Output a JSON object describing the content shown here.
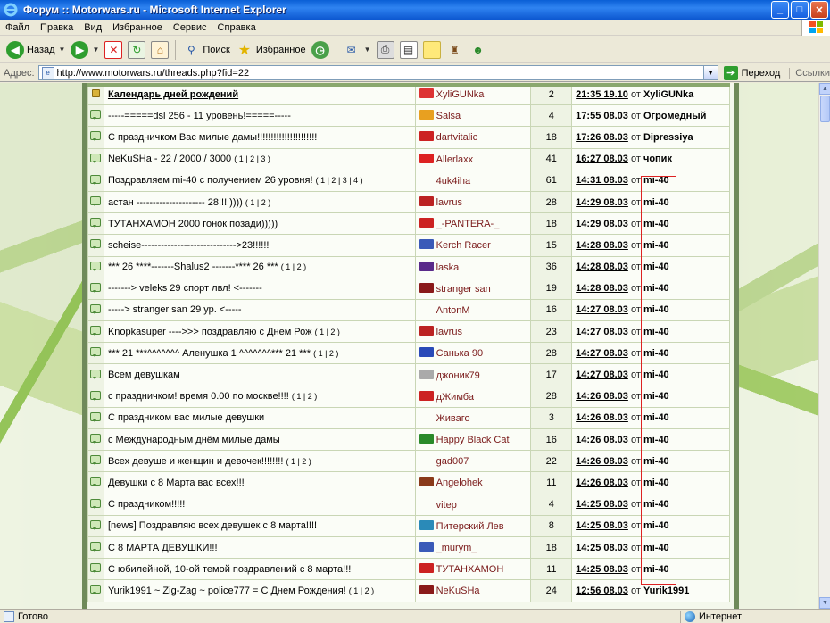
{
  "window": {
    "title": "Форум :: Motorwars.ru - Microsoft Internet Explorer",
    "buttons": {
      "minimize": "_",
      "maximize": "□",
      "close": "✕"
    }
  },
  "menu": [
    "Файл",
    "Правка",
    "Вид",
    "Избранное",
    "Сервис",
    "Справка"
  ],
  "toolbar": {
    "back_label": "Назад",
    "search_label": "Поиск",
    "favorites_label": "Избранное"
  },
  "address": {
    "label": "Адрес:",
    "url": "http://www.motorwars.ru/threads.php?fid=22",
    "go_label": "Переход",
    "links_label": "Ссылки"
  },
  "threads": [
    {
      "icon": "lock-icon",
      "title": "Календарь дней рождений",
      "pages": "",
      "bold": true,
      "author": "XyliGUNka",
      "author_color": "#d33",
      "count": "2",
      "date": "21:35 19.10",
      "by": "от",
      "last_user": "XyliGUNka"
    },
    {
      "icon": "bubble-icon",
      "title": "-----=====dsl 256 - 11 уровень!=====-----",
      "pages": "",
      "author": "Salsa",
      "author_color": "#e8a020",
      "count": "4",
      "date": "17:55 08.03",
      "by": "от",
      "last_user": "Огромедный"
    },
    {
      "icon": "bubble-icon",
      "title": "С праздничком Вас милые дамы!!!!!!!!!!!!!!!!!!!!!!",
      "pages": "",
      "author": "dartvitalic",
      "author_color": "#c22",
      "count": "18",
      "date": "17:26 08.03",
      "by": "от",
      "last_user": "Dipressiya"
    },
    {
      "icon": "bubble-icon",
      "title": "NeKuSHa - 22 / 2000 / 3000",
      "pages": "( 1 | 2 | 3 )",
      "author": "Allerlaxx",
      "author_color": "#d22",
      "count": "41",
      "date": "16:27 08.03",
      "by": "от",
      "last_user": "чопик"
    },
    {
      "icon": "bubble-icon",
      "title": "Поздравляем mi-40 с получением 26 уровня!",
      "pages": "( 1 | 2 | 3 | 4 )",
      "author": "4uk4iha",
      "author_color": "",
      "count": "61",
      "date": "14:31 08.03",
      "by": "от",
      "last_user": "mi-40"
    },
    {
      "icon": "bubble-icon",
      "title": "астан --------------------- 28!!! ))))",
      "pages": "( 1 | 2 )",
      "author": "lavrus",
      "author_color": "#b22",
      "count": "28",
      "date": "14:29 08.03",
      "by": "от",
      "last_user": "mi-40"
    },
    {
      "icon": "bubble-icon",
      "title": "ТУТАНХАМОН 2000 гонок позади)))))",
      "pages": "",
      "author": "_-PANTERA-_",
      "author_color": "#c22",
      "count": "18",
      "date": "14:29 08.03",
      "by": "от",
      "last_user": "mi-40"
    },
    {
      "icon": "bubble-icon",
      "title": "scheise----------------------------->23!!!!!!",
      "pages": "",
      "author": "Kerch Racer",
      "author_color": "#3a5ab8",
      "count": "15",
      "date": "14:28 08.03",
      "by": "от",
      "last_user": "mi-40"
    },
    {
      "icon": "bubble-icon",
      "title": "*** 26 ****-------Shalus2 -------**** 26 ***",
      "pages": "( 1 | 2 )",
      "author": "laska",
      "author_color": "#5a2a8a",
      "count": "36",
      "date": "14:28 08.03",
      "by": "от",
      "last_user": "mi-40"
    },
    {
      "icon": "bubble-icon",
      "title": "-------> veleks 29 спорт лвл! <-------",
      "pages": "",
      "author": "stranger san",
      "author_color": "#8a1a1a",
      "count": "19",
      "date": "14:28 08.03",
      "by": "от",
      "last_user": "mi-40"
    },
    {
      "icon": "bubble-icon",
      "title": "-----> stranger san 29 ур. <-----",
      "pages": "",
      "author": "AntonM",
      "author_color": "",
      "count": "16",
      "date": "14:27 08.03",
      "by": "от",
      "last_user": "mi-40"
    },
    {
      "icon": "bubble-icon",
      "title": "Knopkasuper ---->>> поздравляю с Днем Рож",
      "pages": "( 1 | 2 )",
      "author": "lavrus",
      "author_color": "#b22",
      "count": "23",
      "date": "14:27 08.03",
      "by": "от",
      "last_user": "mi-40"
    },
    {
      "icon": "bubble-icon",
      "title": "*** 21 ***^^^^^^^ Аленушка 1 ^^^^^^^*** 21 ***",
      "pages": "( 1 | 2 )",
      "author": "Санька 90",
      "author_color": "#2a4ab8",
      "count": "28",
      "date": "14:27 08.03",
      "by": "от",
      "last_user": "mi-40"
    },
    {
      "icon": "bubble-icon",
      "title": "Всем девушкам",
      "pages": "",
      "author": "джоник79",
      "author_color": "#aaa",
      "count": "17",
      "date": "14:27 08.03",
      "by": "от",
      "last_user": "mi-40"
    },
    {
      "icon": "bubble-icon",
      "title": "с праздничком! время 0.00 по москве!!!!",
      "pages": "( 1 | 2 )",
      "author": "дЖимба",
      "author_color": "#c22",
      "count": "28",
      "date": "14:26 08.03",
      "by": "от",
      "last_user": "mi-40"
    },
    {
      "icon": "bubble-icon",
      "title": "С праздником вас милые девушки",
      "pages": "",
      "author": "Живаго",
      "author_color": "",
      "count": "3",
      "date": "14:26 08.03",
      "by": "от",
      "last_user": "mi-40"
    },
    {
      "icon": "bubble-icon",
      "title": "с Международным днём милые дамы",
      "pages": "",
      "author": "Happy Black Cat",
      "author_color": "#2a8a2a",
      "count": "16",
      "date": "14:26 08.03",
      "by": "от",
      "last_user": "mi-40"
    },
    {
      "icon": "bubble-icon",
      "title": "Всех девуше и женщин и девочек!!!!!!!!",
      "pages": "( 1 | 2 )",
      "author": "gad007",
      "author_color": "",
      "count": "22",
      "date": "14:26 08.03",
      "by": "от",
      "last_user": "mi-40"
    },
    {
      "icon": "bubble-icon",
      "title": "Девушки с 8 Марта вас всех!!!",
      "pages": "",
      "author": "Angelohek",
      "author_color": "#8a3a1a",
      "count": "11",
      "date": "14:26 08.03",
      "by": "от",
      "last_user": "mi-40"
    },
    {
      "icon": "bubble-icon",
      "title": "С праздником!!!!!",
      "pages": "",
      "author": "vitep",
      "author_color": "",
      "count": "4",
      "date": "14:25 08.03",
      "by": "от",
      "last_user": "mi-40"
    },
    {
      "icon": "bubble-icon",
      "title": "[news] Поздравляю всех девушек с 8 марта!!!!",
      "pages": "",
      "author": "Питерский Лев",
      "author_color": "#2a8ab8",
      "count": "8",
      "date": "14:25 08.03",
      "by": "от",
      "last_user": "mi-40"
    },
    {
      "icon": "bubble-icon",
      "title": "С 8 МАРТА ДЕВУШКИ!!!",
      "pages": "",
      "author": "_murym_",
      "author_color": "#3a5ab8",
      "count": "18",
      "date": "14:25 08.03",
      "by": "от",
      "last_user": "mi-40"
    },
    {
      "icon": "bubble-icon",
      "title": "С юбилейной, 10-ой темой поздравлений с 8 марта!!!",
      "pages": "",
      "author": "ТУТАНХАМОН",
      "author_color": "#c22",
      "count": "11",
      "date": "14:25 08.03",
      "by": "от",
      "last_user": "mi-40"
    },
    {
      "icon": "bubble-icon",
      "title": "Yurik1991 ~ Zig-Zag ~ police777 = С Днем Рождения!",
      "pages": "( 1 | 2 )",
      "author": "NeKuSHa",
      "author_color": "#8a1a1a",
      "count": "24",
      "date": "12:56 08.03",
      "by": "от",
      "last_user": "Yurik1991"
    }
  ],
  "status": {
    "text": "Готово",
    "zone": "Интернет"
  }
}
